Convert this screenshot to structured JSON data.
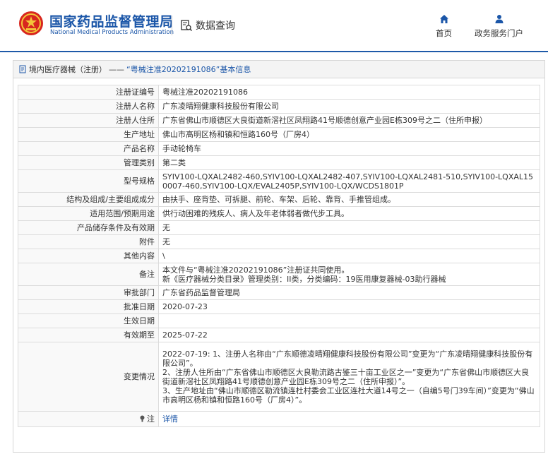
{
  "header": {
    "site_name_cn": "国家药品监督管理局",
    "site_name_en": "National Medical Products Administration",
    "query_label": "数据查询",
    "nav": [
      {
        "label": "首页",
        "icon": "home-icon"
      },
      {
        "label": "政务服务门户",
        "icon": "user-icon"
      }
    ]
  },
  "panel": {
    "breadcrumb_section": "境内医疗器械（注册）",
    "breadcrumb_sep": "——",
    "breadcrumb_title": "“粤械注准20202191086”基本信息"
  },
  "rows": [
    {
      "label": "注册证编号",
      "value": "粤械注准20202191086"
    },
    {
      "label": "注册人名称",
      "value": "广东凌晴翔健康科技股份有限公司"
    },
    {
      "label": "注册人住所",
      "value": "广东省佛山市顺德区大良街道新滘社区凤翔路41号顺德创意产业园E栋309号之二（住所申报）"
    },
    {
      "label": "生产地址",
      "value": "佛山市高明区杨和镇和恒路160号（厂房4）"
    },
    {
      "label": "产品名称",
      "value": "手动轮椅车"
    },
    {
      "label": "管理类别",
      "value": "第二类"
    },
    {
      "label": "型号规格",
      "value": "SYIV100-LQXAL2482-460,SYIV100-LQXAL2482-407,SYIV100-LQXAL2481-510,SYIV100-LQXAL150007-460,SYIV100-LQX/EVAL2405P,SYIV100-LQX/WCDS1801P"
    },
    {
      "label": "结构及组成/主要组成成分",
      "value": "由扶手、座背垫、可拆腿、前轮、车架、后轮、靠背、手推管组成。"
    },
    {
      "label": "适用范围/预期用途",
      "value": "供行动困难的残疾人、病人及年老体弱者做代步工具。"
    },
    {
      "label": "产品储存条件及有效期",
      "value": "无"
    },
    {
      "label": "附件",
      "value": "无"
    },
    {
      "label": "其他内容",
      "value": "\\"
    },
    {
      "label": "备注",
      "lines": [
        "本文件与“粤械注准20202191086”注册证共同使用。",
        "新《医疗器械分类目录》管理类别：II类，分类编码：19医用康复器械-03助行器械"
      ]
    },
    {
      "label": "审批部门",
      "value": "广东省药品监督管理局"
    },
    {
      "label": "批准日期",
      "value": "2020-07-23"
    },
    {
      "label": "生效日期",
      "value": ""
    },
    {
      "label": "有效期至",
      "value": "2025-07-22"
    },
    {
      "label": "变更情况",
      "lines": [
        "2022-07-19: 1、注册人名称由“广东顺德凌晴翔健康科技股份有限公司”变更为“广东凌晴翔健康科技股份有限公司”。",
        "2、注册人住所由“广东省佛山市顺德区大良勒流路古鉴三十亩工业区之一”变更为“广东省佛山市顺德区大良街道新滘社区凤翔路41号顺德创意产业园E栋309号之二（住所申报）”。",
        "3、生产地址由“佛山市顺德区勒流镇连杜村委会工业区连杜大道14号之一（自编5号门39车间）”变更为“佛山市高明区杨和镇和恒路160号（厂房4）”。"
      ]
    },
    {
      "label": "注",
      "value": "详情",
      "icon": "note-icon"
    }
  ],
  "colors": {
    "brand": "#1b56a8"
  }
}
